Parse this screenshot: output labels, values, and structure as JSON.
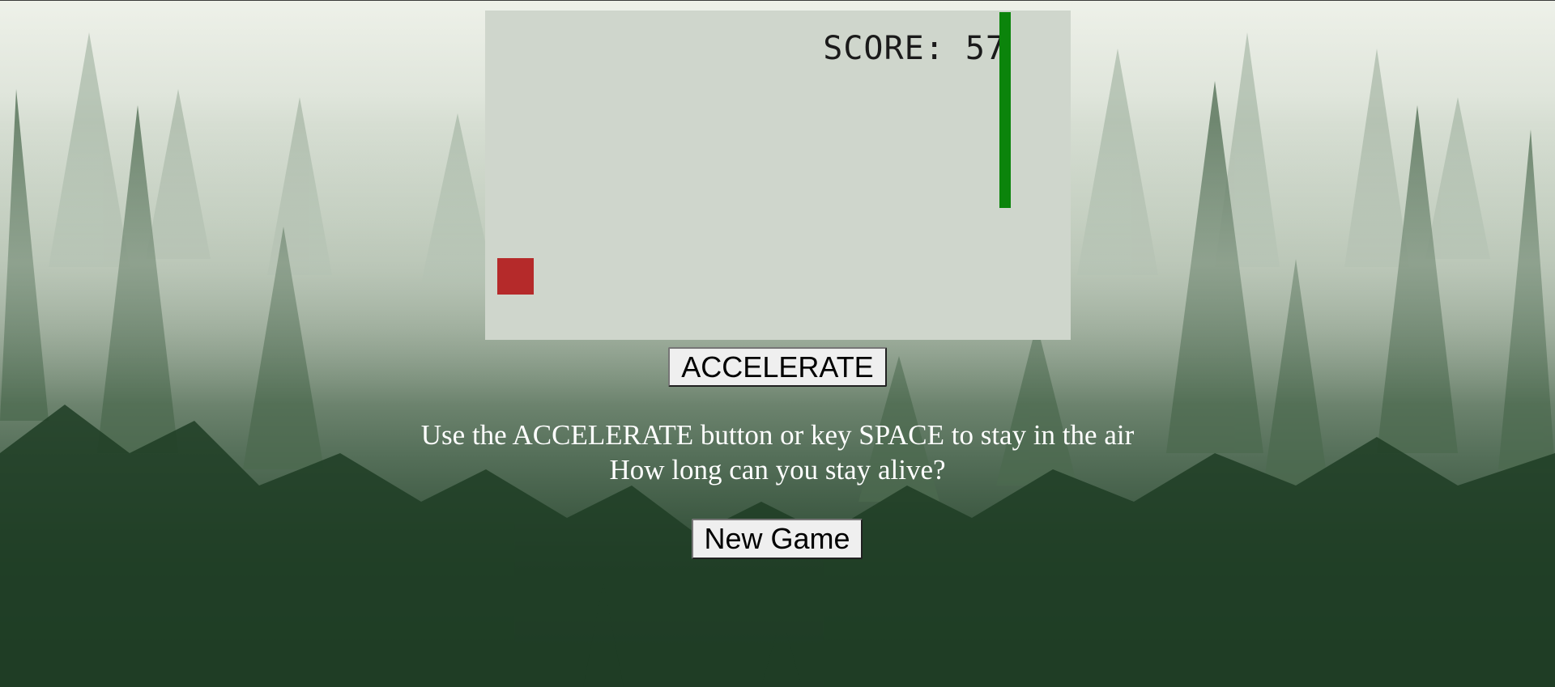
{
  "game": {
    "score_label": "SCORE:",
    "score_value": "57",
    "score_text": "SCORE: 57"
  },
  "controls": {
    "accelerate_label": "ACCELERATE",
    "new_game_label": "New Game"
  },
  "instructions": {
    "line1": "Use the ACCELERATE button or key SPACE to stay in the air",
    "line2": "How long can you stay alive?"
  },
  "colors": {
    "canvas_bg": "#cfd6cc",
    "player": "#b52a2a",
    "obstacle": "#0b840b",
    "text": "#ffffff"
  }
}
